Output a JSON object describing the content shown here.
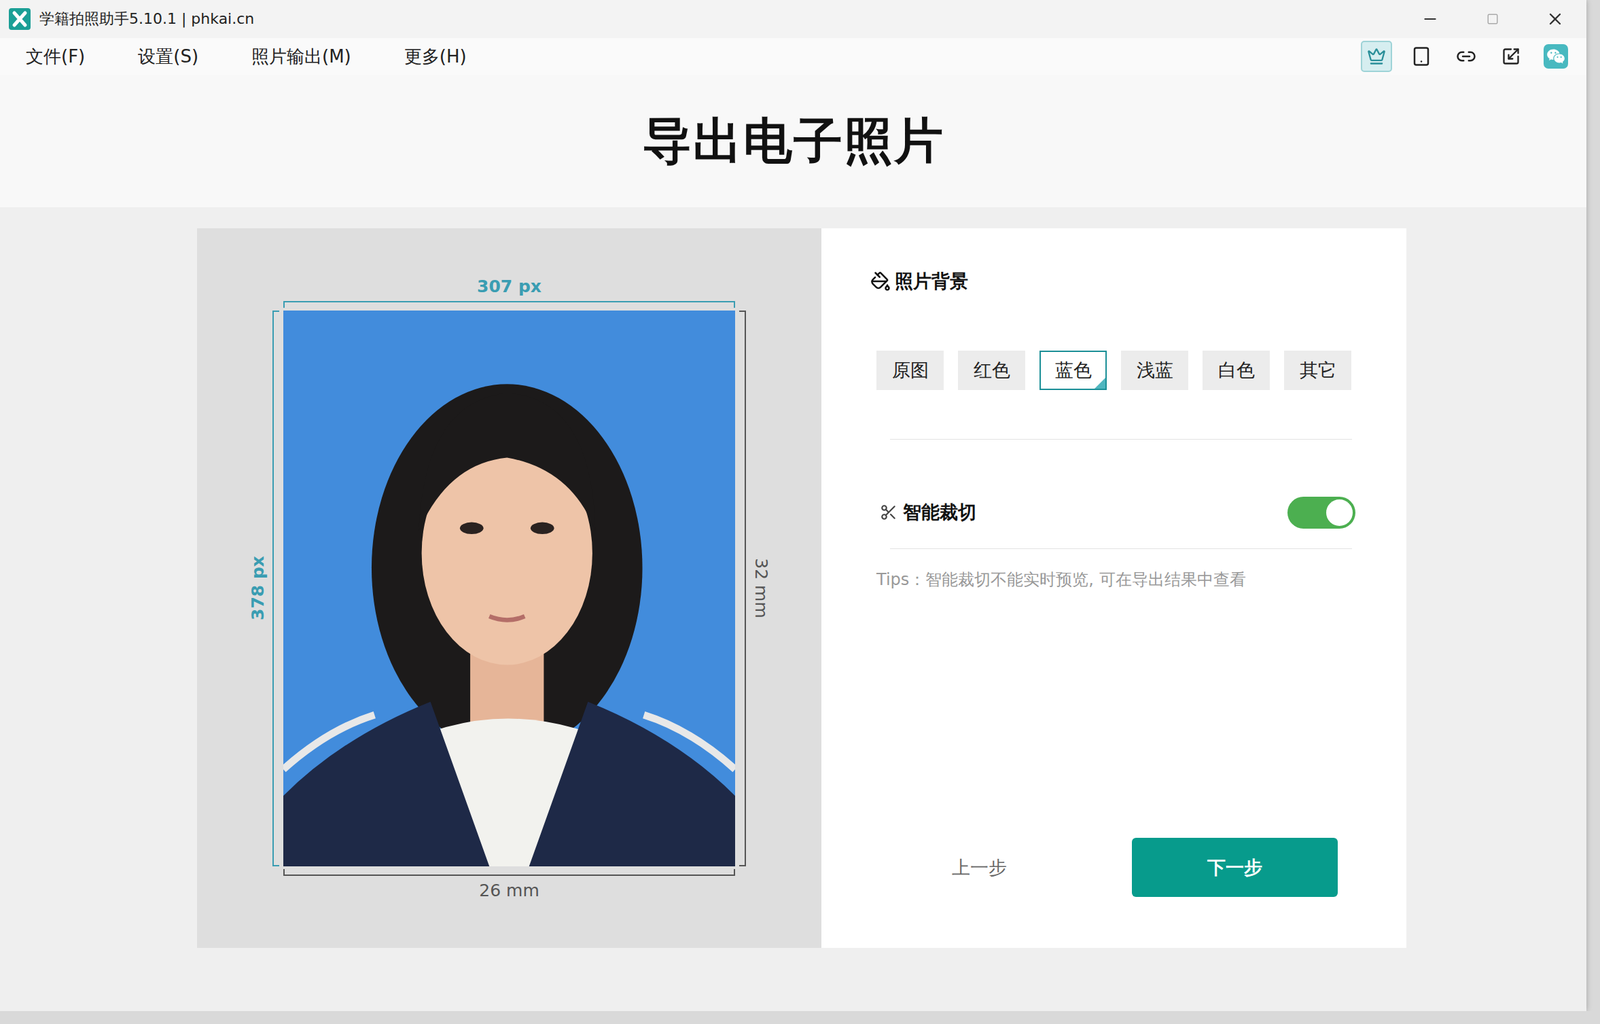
{
  "window": {
    "title": "学籍拍照助手5.10.1 | phkai.cn"
  },
  "menu": [
    "文件(F)",
    "设置(S)",
    "照片输出(M)",
    "更多(H)"
  ],
  "toolbar": [
    {
      "selected": true
    },
    {
      "selected": false
    },
    {
      "selected": false
    },
    {
      "selected": false
    },
    {
      "selected": false
    }
  ],
  "page_title": "导出电子照片",
  "preview": {
    "width_px": "307 px",
    "height_px": "378 px",
    "width_mm": "26 mm",
    "height_mm": "32 mm"
  },
  "background": {
    "title": "照片背景",
    "options": [
      {
        "label": "原图",
        "selected": false
      },
      {
        "label": "红色",
        "selected": false
      },
      {
        "label": "蓝色",
        "selected": true
      },
      {
        "label": "浅蓝",
        "selected": false
      },
      {
        "label": "白色",
        "selected": false
      },
      {
        "label": "其它",
        "selected": false
      }
    ]
  },
  "smart_crop": {
    "label": "智能裁切",
    "on": true,
    "tip": "Tips：智能裁切不能实时预览, 可在导出结果中查看"
  },
  "buttons": {
    "prev": "上一步",
    "next": "下一步"
  }
}
